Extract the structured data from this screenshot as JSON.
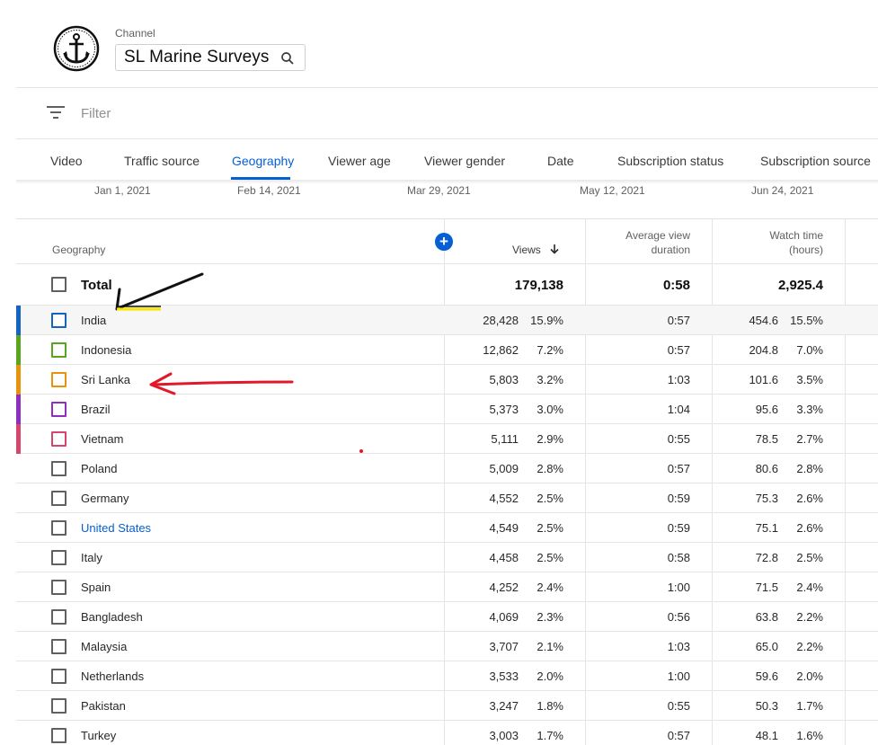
{
  "header": {
    "channel_label": "Channel",
    "channel_name": "SL Marine Surveys"
  },
  "filter": {
    "placeholder": "Filter"
  },
  "tabs": [
    {
      "label": "Video",
      "active": false
    },
    {
      "label": "Traffic source",
      "active": false
    },
    {
      "label": "Geography",
      "active": true
    },
    {
      "label": "Viewer age",
      "active": false
    },
    {
      "label": "Viewer gender",
      "active": false
    },
    {
      "label": "Date",
      "active": false
    },
    {
      "label": "Subscription status",
      "active": false
    },
    {
      "label": "Subscription source",
      "active": false
    }
  ],
  "timeline": [
    "Jan 1, 2021",
    "Feb 14, 2021",
    "Mar 29, 2021",
    "May 12, 2021",
    "Jun 24, 2021"
  ],
  "table": {
    "headers": {
      "geography": "Geography",
      "views": "Views",
      "avg_line1": "Average view",
      "avg_line2": "duration",
      "watch_line1": "Watch time",
      "watch_line2": "(hours)"
    },
    "total": {
      "label": "Total",
      "views": "179,138",
      "avg": "0:58",
      "watch": "2,925.4"
    },
    "rows": [
      {
        "name": "India",
        "views": "28,428",
        "views_pct": "15.9%",
        "avg": "0:57",
        "watch": "454.6",
        "watch_pct": "15.5%",
        "color": "#1565c0",
        "link": false
      },
      {
        "name": "Indonesia",
        "views": "12,862",
        "views_pct": "7.2%",
        "avg": "0:57",
        "watch": "204.8",
        "watch_pct": "7.0%",
        "color": "#5aa51e",
        "link": false
      },
      {
        "name": "Sri Lanka",
        "views": "5,803",
        "views_pct": "3.2%",
        "avg": "1:03",
        "watch": "101.6",
        "watch_pct": "3.5%",
        "color": "#e8930c",
        "link": false
      },
      {
        "name": "Brazil",
        "views": "5,373",
        "views_pct": "3.0%",
        "avg": "1:04",
        "watch": "95.6",
        "watch_pct": "3.3%",
        "color": "#8e2fc0",
        "link": false
      },
      {
        "name": "Vietnam",
        "views": "5,111",
        "views_pct": "2.9%",
        "avg": "0:55",
        "watch": "78.5",
        "watch_pct": "2.7%",
        "color": "#d6456b",
        "link": false
      },
      {
        "name": "Poland",
        "views": "5,009",
        "views_pct": "2.8%",
        "avg": "0:57",
        "watch": "80.6",
        "watch_pct": "2.8%",
        "color": "",
        "link": false
      },
      {
        "name": "Germany",
        "views": "4,552",
        "views_pct": "2.5%",
        "avg": "0:59",
        "watch": "75.3",
        "watch_pct": "2.6%",
        "color": "",
        "link": false
      },
      {
        "name": "United States",
        "views": "4,549",
        "views_pct": "2.5%",
        "avg": "0:59",
        "watch": "75.1",
        "watch_pct": "2.6%",
        "color": "",
        "link": true
      },
      {
        "name": "Italy",
        "views": "4,458",
        "views_pct": "2.5%",
        "avg": "0:58",
        "watch": "72.8",
        "watch_pct": "2.5%",
        "color": "",
        "link": false
      },
      {
        "name": "Spain",
        "views": "4,252",
        "views_pct": "2.4%",
        "avg": "1:00",
        "watch": "71.5",
        "watch_pct": "2.4%",
        "color": "",
        "link": false
      },
      {
        "name": "Bangladesh",
        "views": "4,069",
        "views_pct": "2.3%",
        "avg": "0:56",
        "watch": "63.8",
        "watch_pct": "2.2%",
        "color": "",
        "link": false
      },
      {
        "name": "Malaysia",
        "views": "3,707",
        "views_pct": "2.1%",
        "avg": "1:03",
        "watch": "65.0",
        "watch_pct": "2.2%",
        "color": "",
        "link": false
      },
      {
        "name": "Netherlands",
        "views": "3,533",
        "views_pct": "2.0%",
        "avg": "1:00",
        "watch": "59.6",
        "watch_pct": "2.0%",
        "color": "",
        "link": false
      },
      {
        "name": "Pakistan",
        "views": "3,247",
        "views_pct": "1.8%",
        "avg": "0:55",
        "watch": "50.3",
        "watch_pct": "1.7%",
        "color": "",
        "link": false
      },
      {
        "name": "Turkey",
        "views": "3,003",
        "views_pct": "1.7%",
        "avg": "0:57",
        "watch": "48.1",
        "watch_pct": "1.6%",
        "color": "",
        "link": false
      }
    ]
  },
  "icons": {
    "logo": "anchor-icon",
    "search": "search-icon",
    "filter": "filter-icon",
    "add_metric": "plus-icon",
    "sort": "arrow-down-icon"
  },
  "colors": {
    "accent": "#065fd4"
  }
}
